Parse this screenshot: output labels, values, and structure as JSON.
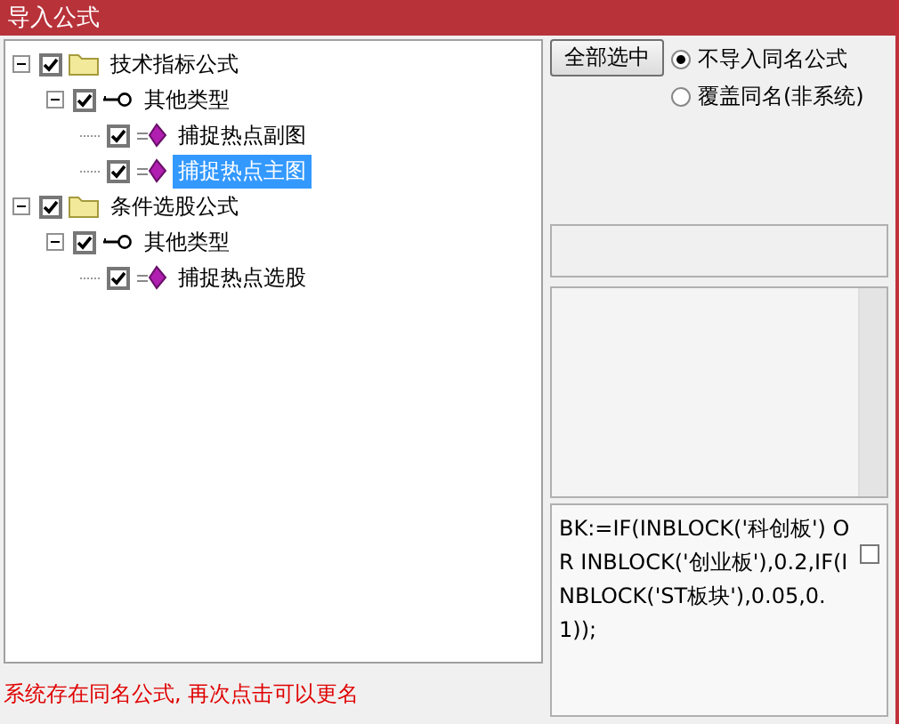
{
  "window": {
    "title": "导入公式"
  },
  "tree": [
    {
      "label": "技术指标公式",
      "kind": "folder",
      "checked": true,
      "expanded": true,
      "selected": false,
      "children": [
        {
          "label": "其他类型",
          "kind": "type",
          "checked": true,
          "expanded": true,
          "selected": false,
          "children": [
            {
              "label": "捕捉热点副图",
              "kind": "formula",
              "checked": true,
              "selected": false
            },
            {
              "label": "捕捉热点主图",
              "kind": "formula",
              "checked": true,
              "selected": true
            }
          ]
        }
      ]
    },
    {
      "label": "条件选股公式",
      "kind": "folder",
      "checked": true,
      "expanded": true,
      "selected": false,
      "children": [
        {
          "label": "其他类型",
          "kind": "type",
          "checked": true,
          "expanded": true,
          "selected": false,
          "children": [
            {
              "label": "捕捉热点选股",
              "kind": "formula",
              "checked": true,
              "selected": false
            }
          ]
        }
      ]
    }
  ],
  "select_all_button": "全部选中",
  "options": [
    {
      "label": "不导入同名公式",
      "selected": true
    },
    {
      "label": "覆盖同名(非系统)",
      "selected": false
    }
  ],
  "formula_text": "BK:=IF(INBLOCK('科创板') OR INBLOCK('创业板'),0.2,IF(INBLOCK('ST板块'),0.05,0.1));",
  "formula_checkbox": {
    "checked": false
  },
  "status": "系统存在同名公式, 再次点击可以更名"
}
